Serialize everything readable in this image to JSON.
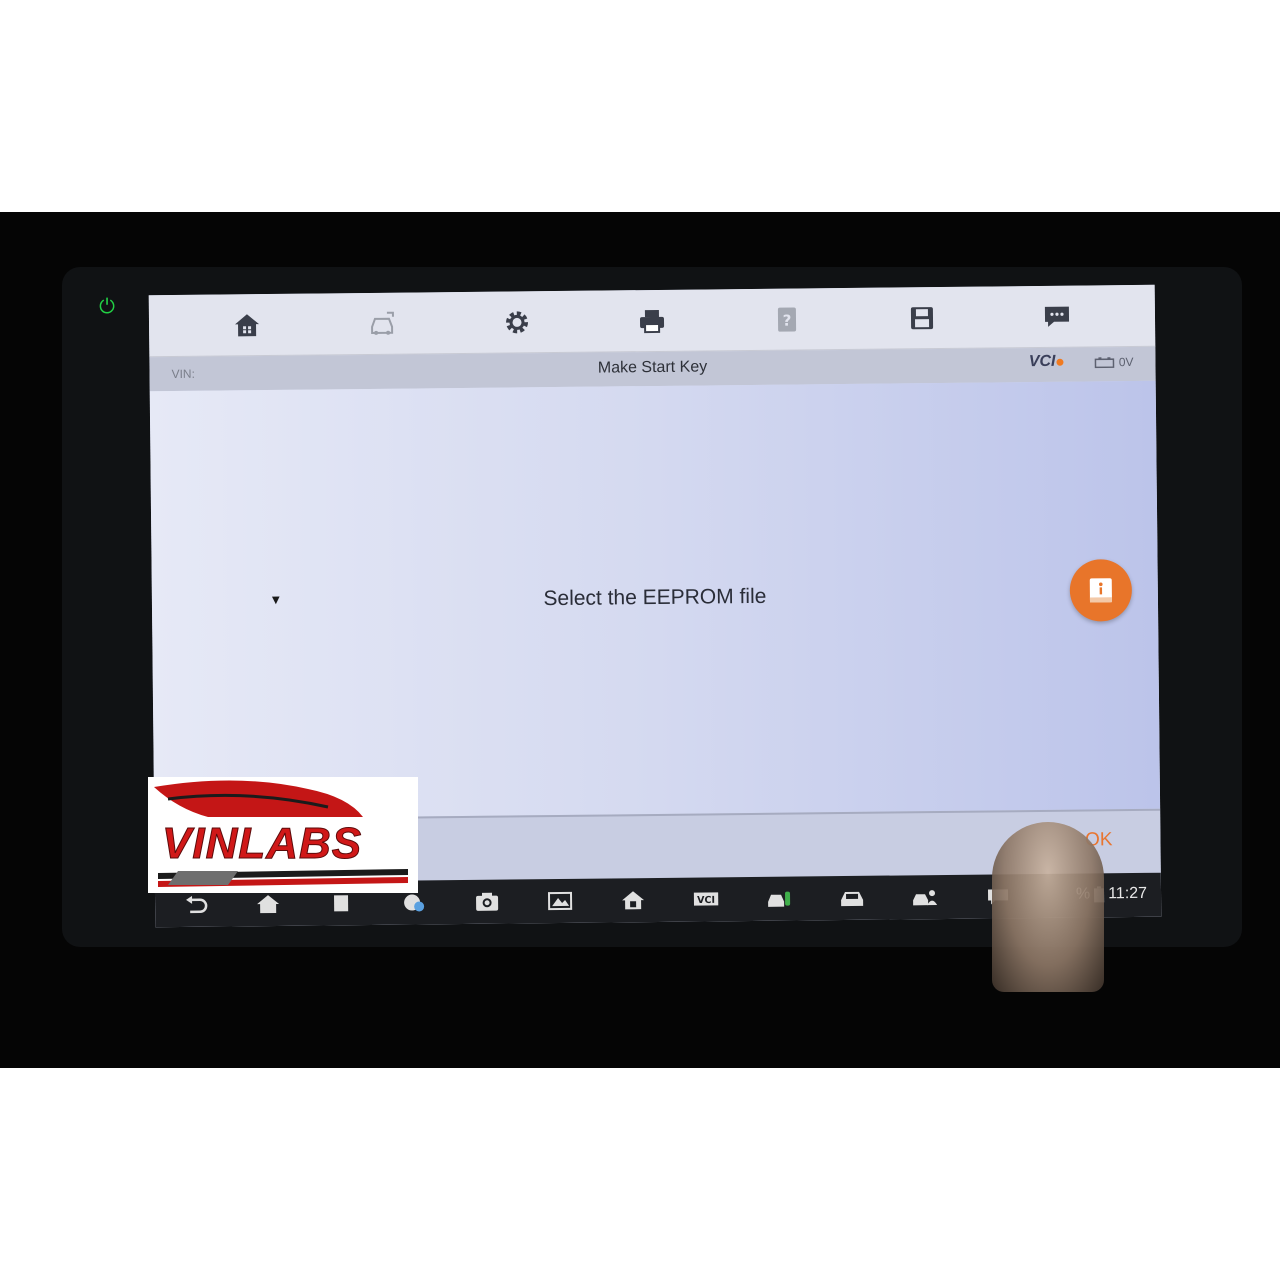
{
  "toolbar": {
    "icons": [
      "home-icon",
      "vehicle-swap-icon",
      "settings-gear-icon",
      "print-icon",
      "help-icon",
      "save-icon",
      "message-icon"
    ]
  },
  "titlebar": {
    "vin_label": "VIN:",
    "title": "Make Start Key",
    "vci_label": "VCI",
    "voltage": "0V"
  },
  "content": {
    "message": "Select the EEPROM file"
  },
  "bottombar": {
    "ok_label": "OK"
  },
  "navbar": {
    "icons": [
      "back-icon",
      "home-icon",
      "recent-apps-icon",
      "browser-icon",
      "camera-icon",
      "screenshot-icon",
      "home-app-icon",
      "vci-icon",
      "vehicle-key-icon",
      "car-icon",
      "car-person-icon",
      "chat-icon"
    ],
    "battery_suffix": "%",
    "clock": "11:27"
  },
  "watermark": {
    "brand": "VINLABS"
  },
  "colors": {
    "accent": "#e8752a",
    "power": "#22d045",
    "brand": "#d01818"
  }
}
